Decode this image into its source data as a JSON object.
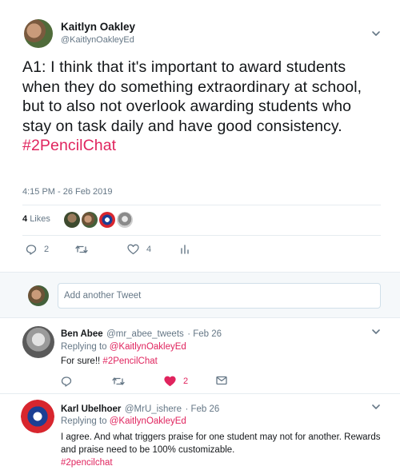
{
  "main": {
    "name": "Kaitlyn Oakley",
    "handle": "@KaitlynOakleyEd",
    "text": "A1: I think that it's important to award students when they do something extraordinary at school, but to also not overlook awarding students who stay on task daily and have good consistency.",
    "hashtag": "#2PencilChat",
    "timestamp": "4:15 PM - 26 Feb 2019",
    "likes_count": "4",
    "likes_label": "Likes",
    "reply_count": "2",
    "like_count": "4"
  },
  "compose": {
    "placeholder": "Add another Tweet"
  },
  "replies": [
    {
      "name": "Ben Abee",
      "handle": "@mr_abee_tweets",
      "date": "· Feb 26",
      "replying_prefix": "Replying to",
      "replying_to": "@KaitlynOakleyEd",
      "text": "For sure!!",
      "hashtag": "#2PencilChat",
      "like_count": "2"
    },
    {
      "name": "Karl Ubelhoer",
      "handle": "@MrU_ishere",
      "date": "· Feb 26",
      "replying_prefix": "Replying to",
      "replying_to": "@KaitlynOakleyEd",
      "text": "I agree. And what triggers praise for one student may not for another. Rewards and praise need to be 100% customizable.",
      "hashtag": "#2pencilchat"
    }
  ],
  "colors": {
    "accent": "#e0245e",
    "muted": "#657786",
    "divider": "#e6ecf0",
    "like_red": "#e0245e"
  },
  "icons": [
    "chevron-down-icon",
    "reply-icon",
    "retweet-icon",
    "heart-icon",
    "stats-icon",
    "message-icon"
  ]
}
